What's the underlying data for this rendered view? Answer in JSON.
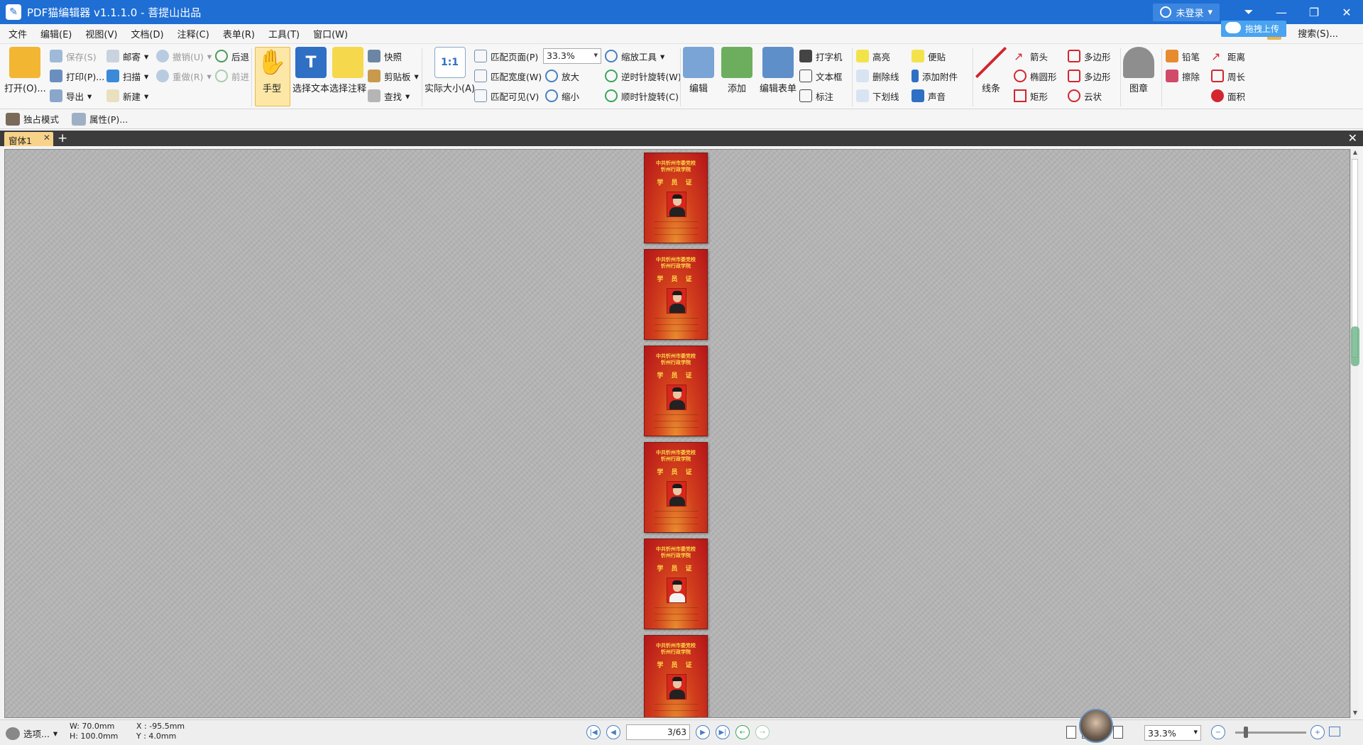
{
  "window": {
    "title": "PDF猫编辑器 v1.1.1.0 - 菩提山出品",
    "login_label": "未登录",
    "upload_label": "拖拽上传"
  },
  "menu": {
    "items": [
      "文件",
      "编辑(E)",
      "视图(V)",
      "文档(D)",
      "注释(C)",
      "表单(R)",
      "工具(T)",
      "窗口(W)"
    ],
    "search_label": "搜索(S)..."
  },
  "ribbon": {
    "open": "打开(O)...",
    "save": "保存(S)",
    "print": "打印(P)...",
    "export": "导出",
    "mail": "邮寄",
    "scan": "扫描",
    "new": "新建",
    "undo": "撤销(U)",
    "redo": "重做(R)",
    "back": "后退",
    "forward": "前进",
    "hand": "手型",
    "select_text": "选择文本",
    "select_annot": "选择注释",
    "snapshot": "快照",
    "clipboard": "剪贴板",
    "find": "查找",
    "actual_size": "实际大小(A)",
    "actual_size_icon": "1:1",
    "fit_page": "匹配页面(P)",
    "fit_width": "匹配宽度(W)",
    "fit_visible": "匹配可见(V)",
    "zoom_value": "33.3%",
    "zoom_tool": "缩放工具",
    "zoom_in": "放大",
    "zoom_out": "缩小",
    "rotate_ccw": "逆时针旋转(W)",
    "rotate_cw": "顺时针旋转(C)",
    "edit": "编辑",
    "add": "添加",
    "edit_form": "编辑表单",
    "typewriter": "打字机",
    "textbox": "文本框",
    "callout": "标注",
    "highlight": "高亮",
    "strikeout": "删除线",
    "underline": "下划线",
    "note": "便贴",
    "attach": "添加附件",
    "sound": "声音",
    "line": "线条",
    "arrow": "箭头",
    "ellipse": "椭圆形",
    "rect": "矩形",
    "polygon1": "多边形",
    "polygon2": "多边形",
    "cloud": "云状",
    "stamp": "图章",
    "pencil": "铅笔",
    "eraser": "擦除",
    "distance": "距离",
    "perimeter": "周长",
    "area": "面积"
  },
  "quickbar": {
    "exclusive": "独占模式",
    "properties": "属性(P)..."
  },
  "tabs": {
    "active": "窗体1",
    "add": "+"
  },
  "document": {
    "card_title_line1": "中共忻州市委党校",
    "card_title_line2": "忻州行政学院",
    "card_heading": "学 员 证",
    "pages": [
      {
        "shirt": "dark"
      },
      {
        "shirt": "dark"
      },
      {
        "shirt": "dark"
      },
      {
        "shirt": "dark"
      },
      {
        "shirt": "light"
      },
      {
        "shirt": "dark"
      }
    ]
  },
  "status": {
    "options": "选项...",
    "width": "W: 70.0mm",
    "height": "H: 100.0mm",
    "x": "X : -95.5mm",
    "y": "Y :   4.0mm",
    "page_indicator": "3/63",
    "zoom_value": "33.3%"
  }
}
